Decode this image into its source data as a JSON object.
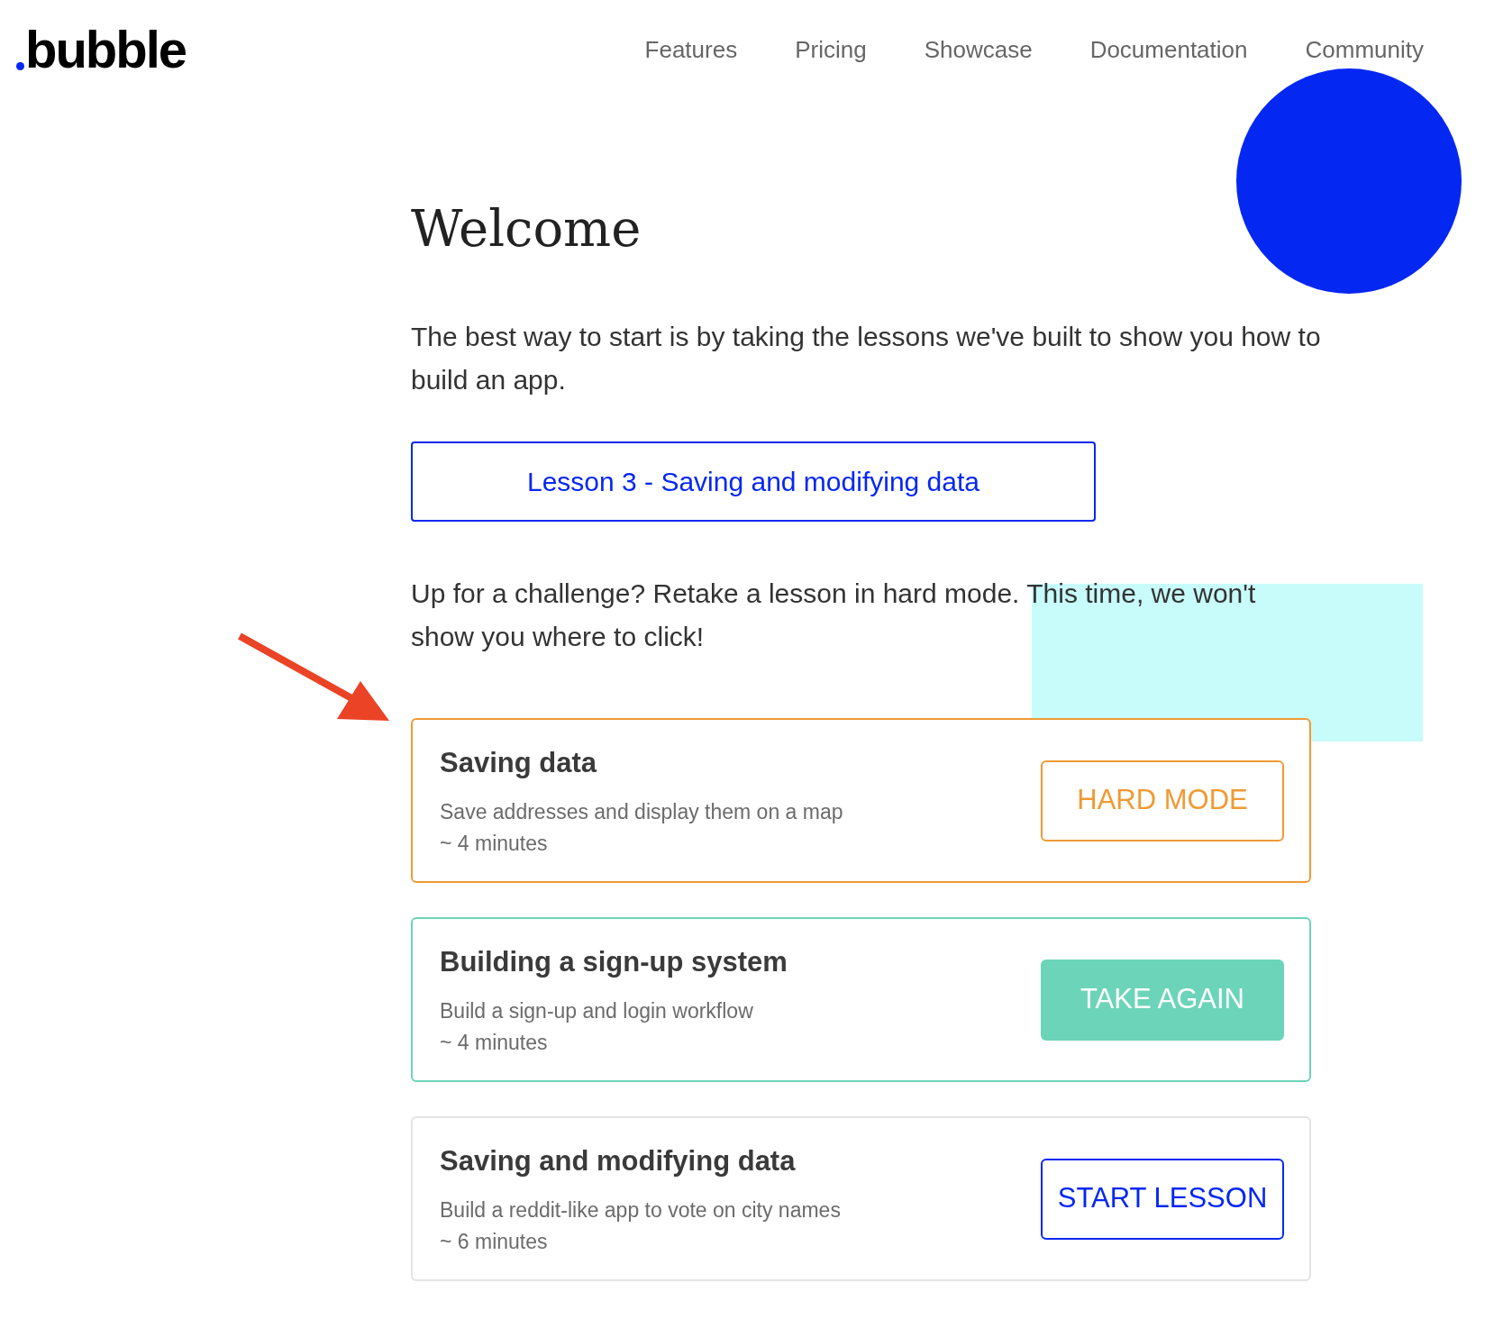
{
  "header": {
    "logo": "bubble",
    "nav": [
      "Features",
      "Pricing",
      "Showcase",
      "Documentation",
      "Community"
    ]
  },
  "title": "Welcome",
  "intro": "The best way to start is by taking the lessons we've built to show you how to build an app.",
  "lesson_button": "Lesson 3 - Saving and modifying data",
  "challenge": "Up for a challenge? Retake a lesson in hard mode. This time, we won't show you where to click!",
  "lessons": [
    {
      "kind": "hard",
      "title": "Saving data",
      "description": "Save addresses and display them on a map",
      "duration": "~ 4 minutes",
      "button": "HARD MODE"
    },
    {
      "kind": "done",
      "title": "Building a sign-up system",
      "description": "Build a sign-up and login workflow",
      "duration": "~ 4 minutes",
      "button": "TAKE AGAIN"
    },
    {
      "kind": "start",
      "title": "Saving and modifying data",
      "description": "Build a reddit-like app to vote on city names",
      "duration": "~ 6 minutes",
      "button": "START LESSON"
    }
  ]
}
